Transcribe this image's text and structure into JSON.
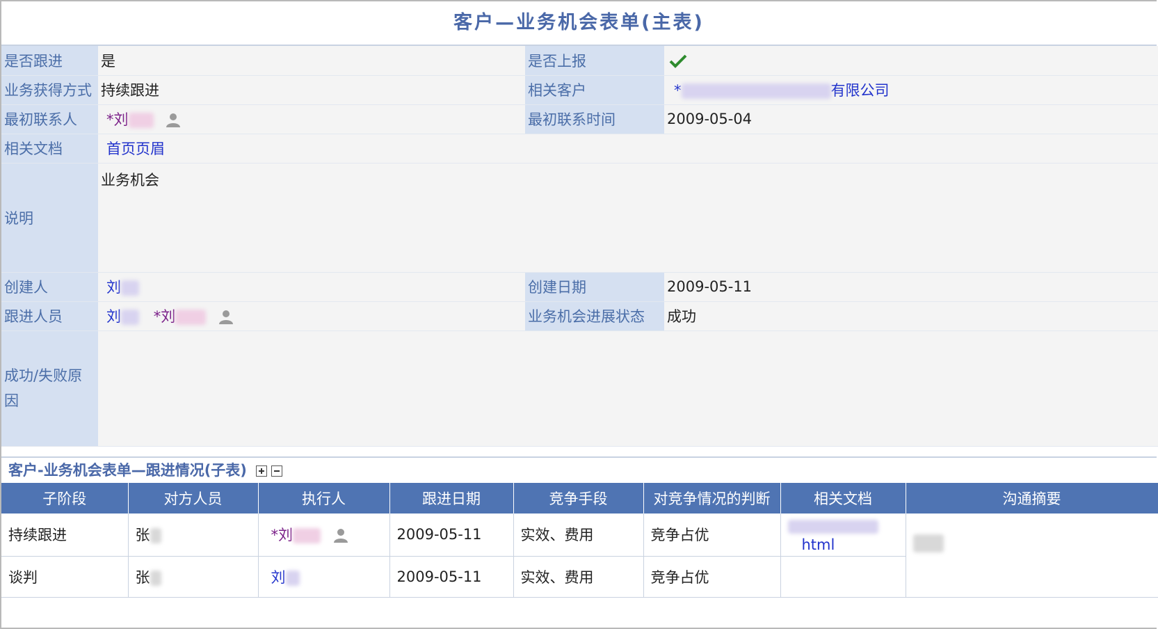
{
  "title": "客户—业务机会表单(主表)",
  "form": {
    "follow_label": "是否跟进",
    "follow_value": "是",
    "reported_label": "是否上报",
    "method_label": "业务获得方式",
    "method_value": "持续跟进",
    "customer_label": "相关客户",
    "customer_prefix": "*",
    "customer_suffix": "有限公司",
    "contact_label": "最初联系人",
    "contact_value": "*刘",
    "contact_time_label": "最初联系时间",
    "contact_time_value": "2009-05-04",
    "doc_label": "相关文档",
    "doc_value": "首页页眉",
    "desc_label": "说明",
    "desc_value": "业务机会",
    "creator_label": "创建人",
    "creator_value": "刘",
    "created_label": "创建日期",
    "created_value": "2009-05-11",
    "followers_label": "跟进人员",
    "follower1": "刘",
    "follower2": "*刘",
    "status_label": "业务机会进展状态",
    "status_value": "成功",
    "reason_label": "成功/失败原因"
  },
  "subtable": {
    "title": "客户-业务机会表单—跟进情况(子表)",
    "headers": [
      "子阶段",
      "对方人员",
      "执行人",
      "跟进日期",
      "竞争手段",
      "对竞争情况的判断",
      "相关文档",
      "沟通摘要"
    ],
    "rows": [
      {
        "stage": "持续跟进",
        "counterpart": "张",
        "executor": "*刘",
        "date": "2009-05-11",
        "means": "实效、费用",
        "judgement": "竞争占优",
        "doc": "html"
      },
      {
        "stage": "谈判",
        "counterpart": "张",
        "executor": "刘",
        "date": "2009-05-11",
        "means": "实效、费用",
        "judgement": "竞争占优",
        "doc": ""
      }
    ]
  },
  "colors": {
    "label_bg": "#d5e0f1",
    "header_bg": "#4f74b3",
    "title": "#4a68a8"
  }
}
